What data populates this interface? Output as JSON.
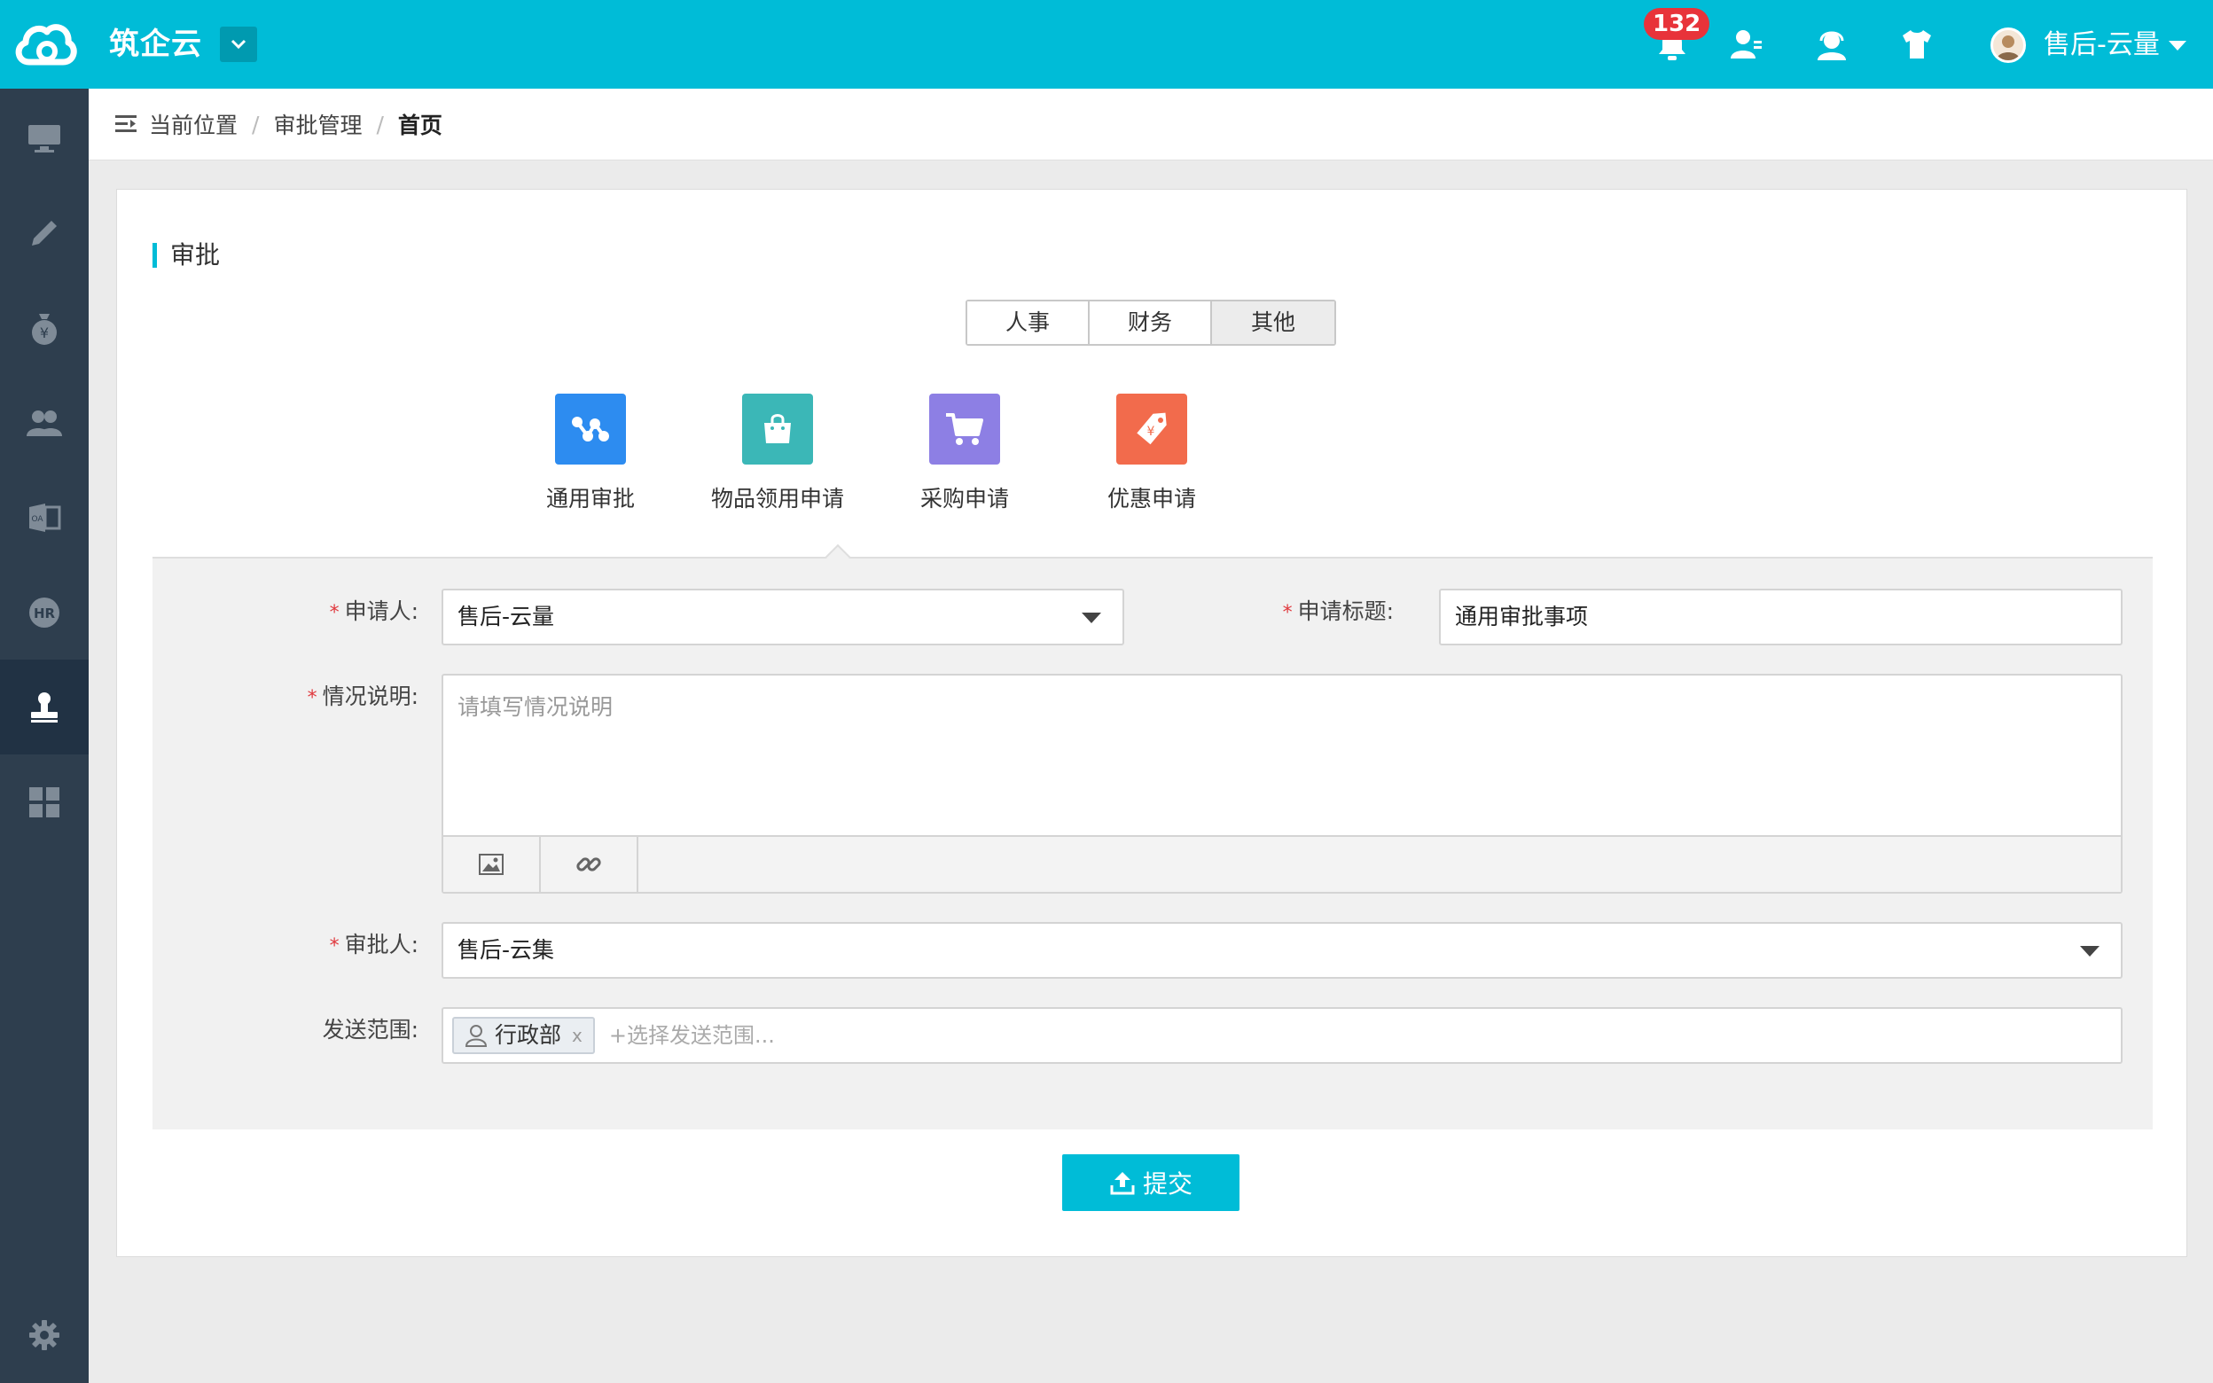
{
  "topbar": {
    "app_name": "筑企云",
    "notification_count": "132",
    "user_name": "售后-云量",
    "brand_color": "#00bcd7"
  },
  "sidebar": {
    "items": [
      {
        "icon": "monitor-icon"
      },
      {
        "icon": "pencil-icon"
      },
      {
        "icon": "money-bag-icon"
      },
      {
        "icon": "users-icon"
      },
      {
        "icon": "oa-icon"
      },
      {
        "icon": "hr-icon"
      },
      {
        "icon": "stamp-icon",
        "active": true
      },
      {
        "icon": "grid-icon"
      }
    ],
    "settings_icon": "gear-icon"
  },
  "breadcrumb": {
    "prefix": "当前位置",
    "items": [
      "审批管理",
      "首页"
    ]
  },
  "section": {
    "title": "审批"
  },
  "tabs": [
    {
      "label": "人事",
      "active": false
    },
    {
      "label": "财务",
      "active": false
    },
    {
      "label": "其他",
      "active": true
    }
  ],
  "apps": [
    {
      "label": "通用审批",
      "color": "#2d8cf0",
      "icon": "workflow-icon"
    },
    {
      "label": "物品领用申请",
      "color": "#3bb7b7",
      "icon": "shopping-bag-icon"
    },
    {
      "label": "采购申请",
      "color": "#8d7fe4",
      "icon": "shopping-cart-icon"
    },
    {
      "label": "优惠申请",
      "color": "#f26b4c",
      "icon": "price-tag-icon"
    }
  ],
  "form": {
    "applicant": {
      "label": "申请人:",
      "value": "售后-云量"
    },
    "title": {
      "label": "申请标题:",
      "value": "通用审批事项"
    },
    "description": {
      "label": "情况说明:",
      "placeholder": "请填写情况说明"
    },
    "approver": {
      "label": "审批人:",
      "value": "售后-云集"
    },
    "scope": {
      "label": "发送范围:",
      "tags": [
        "行政部"
      ],
      "remove": "x",
      "placeholder": "+选择发送范围..."
    },
    "required_mark": "*"
  },
  "submit": {
    "label": "提交"
  }
}
